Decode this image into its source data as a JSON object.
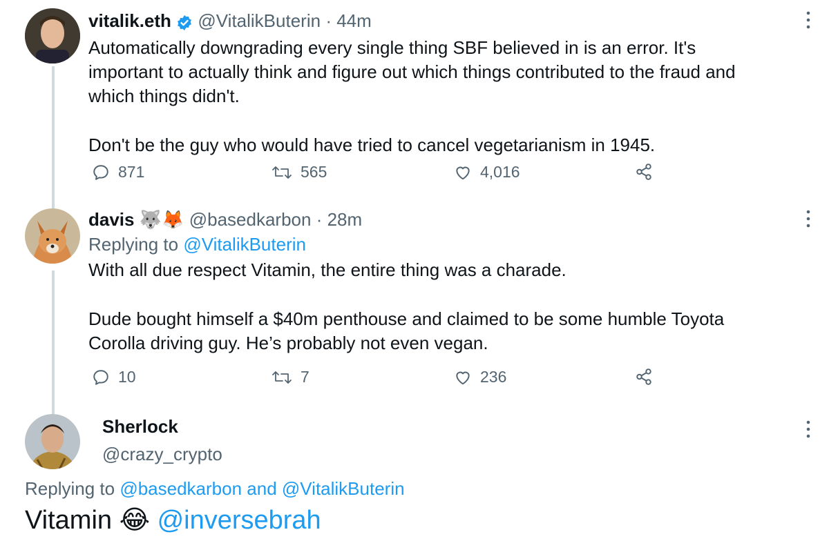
{
  "tweet1": {
    "display_name": "vitalik.eth",
    "handle": "@VitalikButerin",
    "separator": "·",
    "time": "44m",
    "body_lines": [
      "Automatically downgrading every single thing SBF believed in is an error. It's",
      "important to actually think and figure out which things contributed to the fraud and",
      "which things didn't.",
      "",
      "Don't be the guy who would have tried to cancel vegetarianism in 1945."
    ],
    "replies": "871",
    "retweets": "565",
    "likes": "4,016"
  },
  "tweet2": {
    "display_name": "davis",
    "emojis": "🐺🦊",
    "handle": "@basedkarbon",
    "separator": "·",
    "time": "28m",
    "replying_prefix": "Replying to",
    "replying_to": "@VitalikButerin",
    "body_lines": [
      "With all due respect Vitamin, the entire thing was a charade.",
      "",
      "Dude bought himself a $40m penthouse and claimed to be some humble Toyota",
      "Corolla driving guy. He’s probably not even vegan."
    ],
    "replies": "10",
    "retweets": "7",
    "likes": "236"
  },
  "tweet3": {
    "display_name": "Sherlock",
    "handle": "@crazy_crypto",
    "replying_prefix": "Replying to",
    "replying_to_1": "@basedkarbon",
    "and_word": "and",
    "replying_to_2": "@VitalikButerin",
    "body_word": "Vitamin",
    "body_emoji": "😂",
    "mention": "@inversebrah"
  },
  "colors": {
    "text": "#0f1419",
    "muted": "#536471",
    "link": "#1d9bf0",
    "verified": "#1d9bf0",
    "thread_line": "#cfd9de"
  },
  "icons": [
    "reply-icon",
    "retweet-icon",
    "like-icon",
    "share-icon",
    "more-icon",
    "verified-badge-icon"
  ]
}
